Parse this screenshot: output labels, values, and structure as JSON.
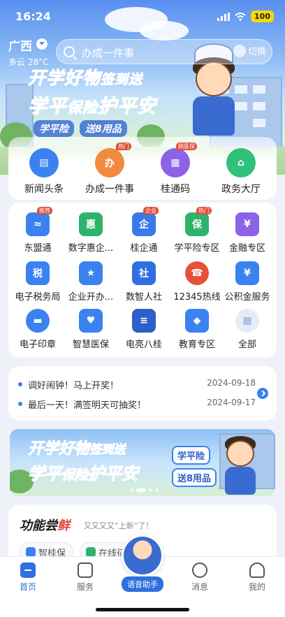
{
  "status": {
    "time": "16:24",
    "battery": "100"
  },
  "header": {
    "location": "广西",
    "weather": "多云 28°C",
    "search_placeholder": "办成一件事",
    "switch_label": "切换"
  },
  "hero_banner": {
    "line1_big": "开学好物",
    "line1_small": "签到送",
    "line2_big": "学平",
    "line2_small": "保险",
    "line2_big2": "护平安",
    "tag1": "学平险",
    "tag2": "送8用品"
  },
  "quick_row": [
    {
      "label": "新闻头条",
      "icon": "news-icon",
      "tag": "",
      "color": "#3a82f0"
    },
    {
      "label": "办成一件事",
      "icon": "task-icon",
      "tag": "热门",
      "color": "#f08a3c"
    },
    {
      "label": "桂通码",
      "icon": "qrcode-icon",
      "tag": "刷医保",
      "color": "#8b62e8"
    },
    {
      "label": "政务大厅",
      "icon": "government-hall-icon",
      "tag": "",
      "color": "#2fc07a"
    }
  ],
  "grid": [
    {
      "label": "东盟通",
      "tag": "推荐",
      "color": "#3a82f0",
      "glyph": "≈"
    },
    {
      "label": "数字惠企...",
      "tag": "",
      "color": "#2fb36a",
      "glyph": "惠"
    },
    {
      "label": "桂企通",
      "tag": "企业",
      "color": "#3a7ae8",
      "glyph": "企"
    },
    {
      "label": "学平险专区",
      "tag": "热门",
      "color": "#2fb36a",
      "glyph": "保"
    },
    {
      "label": "金融专区",
      "tag": "",
      "color": "#8b62e8",
      "glyph": "¥"
    },
    {
      "label": "电子税务局",
      "tag": "",
      "color": "#3a82f0",
      "glyph": "税"
    },
    {
      "label": "企业开办...",
      "tag": "",
      "color": "#3a82f0",
      "glyph": "★"
    },
    {
      "label": "数智人社",
      "tag": "",
      "color": "#2f6fe0",
      "glyph": "社"
    },
    {
      "label": "12345热线",
      "tag": "",
      "color": "#e8503a",
      "glyph": "☎"
    },
    {
      "label": "公积金服务",
      "tag": "",
      "color": "#3a82f0",
      "glyph": "¥"
    },
    {
      "label": "电子印章",
      "tag": "",
      "color": "#3a82f0",
      "glyph": "▬"
    },
    {
      "label": "智慧医保",
      "tag": "",
      "color": "#3a82f0",
      "glyph": "♥"
    },
    {
      "label": "电亮八桂",
      "tag": "",
      "color": "#2f5fc8",
      "glyph": "≡"
    },
    {
      "label": "教育专区",
      "tag": "",
      "color": "#3a82f0",
      "glyph": "◆"
    },
    {
      "label": "全部",
      "tag": "",
      "color": "#8fa8d8",
      "glyph": "▦"
    }
  ],
  "news": [
    {
      "text": "调好闹钟！马上开奖！",
      "date": "2024-09-18"
    },
    {
      "text": "最后一天！满签明天可抽奖！",
      "date": "2024-09-17"
    }
  ],
  "banner2": {
    "line1_big": "开学好物",
    "line1_small": "签到送",
    "line2_big": "学平",
    "line2_small": "保险",
    "line2_big2": "护平安",
    "tag1": "学平险",
    "tag2": "送8用品"
  },
  "feature": {
    "title_a": "功能尝",
    "title_b": "鲜",
    "subtitle": "又又又又“上新”了！",
    "pills": [
      "智桂保",
      "在线征"
    ]
  },
  "tabs": [
    {
      "label": "首页",
      "active": true
    },
    {
      "label": "服务",
      "active": false
    },
    {
      "label": "消息",
      "active": false
    },
    {
      "label": "我的",
      "active": false
    }
  ],
  "voice_assistant": "语音助手",
  "colors": {
    "primary": "#2f6fe0",
    "tag_red": "#e0503c",
    "banner_yellow": "#f6c40c"
  }
}
